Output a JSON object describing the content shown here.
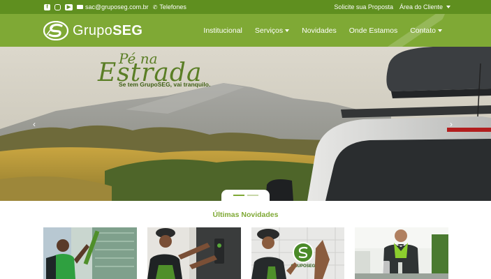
{
  "topbar": {
    "social_icons": [
      "facebook-icon",
      "instagram-icon",
      "youtube-icon"
    ],
    "email": "sac@gruposeg.com.br",
    "phone_label": "Telefones",
    "quote_link": "Solicite sua Proposta",
    "client_area": "Área do Cliente"
  },
  "nav": {
    "logo_text_a": "Grupo",
    "logo_text_b": "SEG",
    "items": [
      {
        "label": "Institucional",
        "dropdown": false
      },
      {
        "label": "Serviços",
        "dropdown": true
      },
      {
        "label": "Novidades",
        "dropdown": false
      },
      {
        "label": "Onde Estamos",
        "dropdown": false
      },
      {
        "label": "Contato",
        "dropdown": true
      }
    ]
  },
  "hero": {
    "title_line1": "Pé na",
    "title_line2": "Estrada",
    "subtitle": "Se tem GrupoSEG, vai tranquilo."
  },
  "news": {
    "title": "Últimas Novidades",
    "badge_text": "GRUPOSEG"
  },
  "colors": {
    "topbar": "#5f8f1f",
    "nav": "#7fa935",
    "accent_text": "#5a7e25"
  }
}
